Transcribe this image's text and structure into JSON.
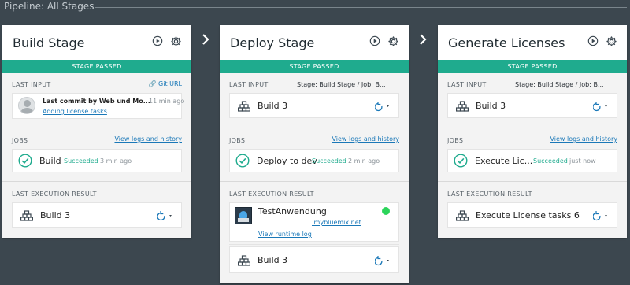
{
  "pipeline": {
    "title": "Pipeline: All Stages"
  },
  "stages": [
    {
      "name": "Build Stage",
      "status": "STAGE PASSED",
      "last_input_label": "LAST INPUT",
      "last_input_link": "Git URL",
      "commit_text": "Last commit by Web und Mo...",
      "commit_time": "11 min ago",
      "commit_link": "Adding license tasks",
      "jobs_label": "JOBS",
      "jobs_link": "View logs and history",
      "job_name": "Build",
      "job_status": "Succeeded",
      "job_time": "3 min ago",
      "result_label": "LAST EXECUTION RESULT",
      "result_build": "Build 3"
    },
    {
      "name": "Deploy Stage",
      "status": "STAGE PASSED",
      "last_input_label": "LAST INPUT",
      "last_input_info": "Stage: Build Stage  /  Job: B...",
      "input_build": "Build 3",
      "jobs_label": "JOBS",
      "jobs_link": "View logs and history",
      "job_name": "Deploy to dev",
      "job_status": "Succeeded",
      "job_time": "2 min ago",
      "result_label": "LAST EXECUTION RESULT",
      "app_name": "TestAnwendung",
      "app_url": ".mybluemix.net",
      "runtime_link": "View runtime log",
      "result_build": "Build 3",
      "app_status_color": "#2bd45a"
    },
    {
      "name": "Generate Licenses",
      "status": "STAGE PASSED",
      "last_input_label": "LAST INPUT",
      "last_input_info": "Stage: Build Stage  /  Job: B...",
      "input_build": "Build 3",
      "jobs_label": "JOBS",
      "jobs_link": "View logs and history",
      "job_name": "Execute Lic...",
      "job_status": "Succeeded",
      "job_time": "just now",
      "result_label": "LAST EXECUTION RESULT",
      "result_build": "Execute License tasks 6"
    }
  ],
  "colors": {
    "accent": "#1fab8e",
    "link": "#1a78b8",
    "background": "#3c474f"
  },
  "icons": [
    "play-icon",
    "gear-icon",
    "chevron-right-icon",
    "git-link-icon",
    "avatar-icon",
    "check-circle-icon",
    "build-blocks-icon",
    "redeploy-icon",
    "chevron-down-icon",
    "app-icon",
    "status-dot-icon"
  ]
}
